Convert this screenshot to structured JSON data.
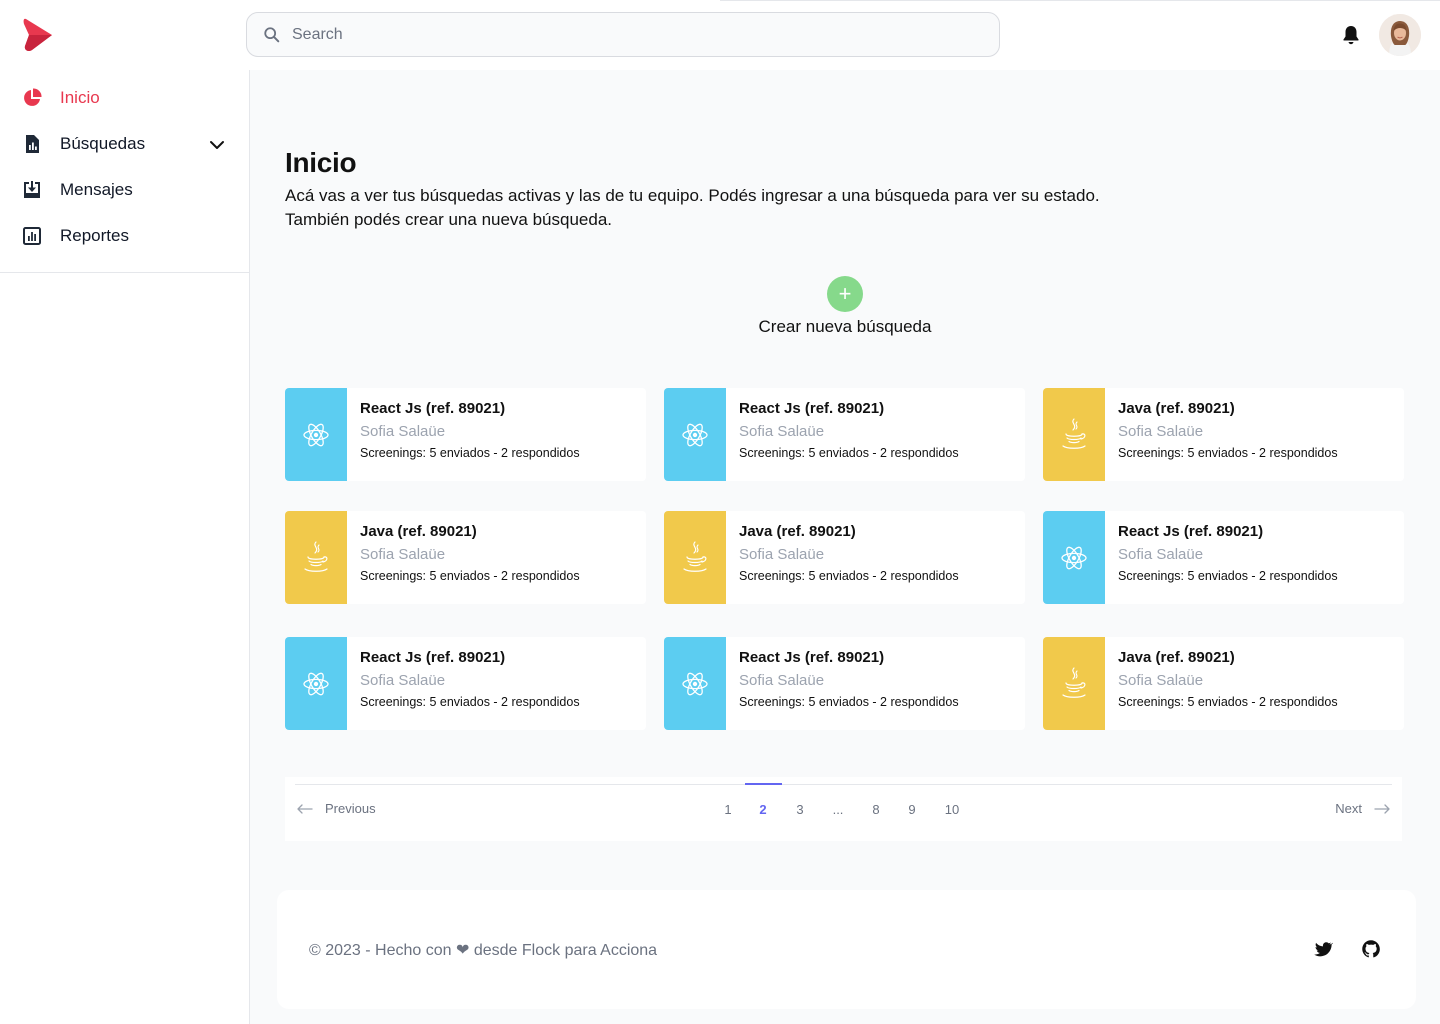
{
  "colors": {
    "accent": "#e8384f",
    "react": "#5ccdf1",
    "java": "#f1c94b",
    "create": "#86d98b",
    "pager_active": "#6366f1"
  },
  "header": {
    "search": {
      "placeholder": "Search",
      "value": ""
    },
    "icons": {
      "logo": "play-logo",
      "bell": "bell-icon",
      "avatar": "user-avatar"
    }
  },
  "sidebar": {
    "items": [
      {
        "label": "Inicio",
        "icon": "pie-chart-icon",
        "active": true
      },
      {
        "label": "Búsquedas",
        "icon": "document-chart-icon",
        "active": false,
        "expandable": true
      },
      {
        "label": "Mensajes",
        "icon": "inbox-download-icon",
        "active": false
      },
      {
        "label": "Reportes",
        "icon": "bar-chart-icon",
        "active": false
      }
    ]
  },
  "main": {
    "title": "Inicio",
    "description_1": "Acá vas a ver tus búsquedas activas y las de tu equipo. Podés ingresar a una búsqueda para ver su estado.",
    "description_2": "También podés crear una nueva búsqueda.",
    "create_label": "Crear nueva búsqueda",
    "create_icon": "+",
    "cards": [
      {
        "type": "react",
        "title": "React Js (ref. 89021)",
        "owner": "Sofia Salaüe",
        "stats": "Screenings: 5 enviados - 2 respondidos"
      },
      {
        "type": "react",
        "title": "React Js (ref. 89021)",
        "owner": "Sofia Salaüe",
        "stats": "Screenings: 5 enviados - 2 respondidos"
      },
      {
        "type": "java",
        "title": "Java (ref. 89021)",
        "owner": "Sofia Salaüe",
        "stats": "Screenings: 5 enviados - 2 respondidos"
      },
      {
        "type": "java",
        "title": "Java (ref. 89021)",
        "owner": "Sofia Salaüe",
        "stats": "Screenings: 5 enviados - 2 respondidos"
      },
      {
        "type": "java",
        "title": "Java (ref. 89021)",
        "owner": "Sofia Salaüe",
        "stats": "Screenings: 5 enviados - 2 respondidos"
      },
      {
        "type": "react",
        "title": "React Js (ref. 89021)",
        "owner": "Sofia Salaüe",
        "stats": "Screenings: 5 enviados - 2 respondidos"
      },
      {
        "type": "react",
        "title": "React Js (ref. 89021)",
        "owner": "Sofia Salaüe",
        "stats": "Screenings: 5 enviados - 2 respondidos"
      },
      {
        "type": "react",
        "title": "React Js (ref. 89021)",
        "owner": "Sofia Salaüe",
        "stats": "Screenings: 5 enviados - 2 respondidos"
      },
      {
        "type": "java",
        "title": "Java (ref. 89021)",
        "owner": "Sofia Salaüe",
        "stats": "Screenings: 5 enviados - 2 respondidos"
      }
    ],
    "pagination": {
      "previous": "Previous",
      "next": "Next",
      "pages": [
        "1",
        "2",
        "3",
        "...",
        "8",
        "9",
        "10"
      ],
      "current": "2"
    }
  },
  "footer": {
    "copyright_prefix": "© 2023 - Hecho con",
    "heart": "❤",
    "copyright_suffix": "desde Flock para Acciona",
    "social": [
      "twitter-icon",
      "github-icon"
    ]
  }
}
